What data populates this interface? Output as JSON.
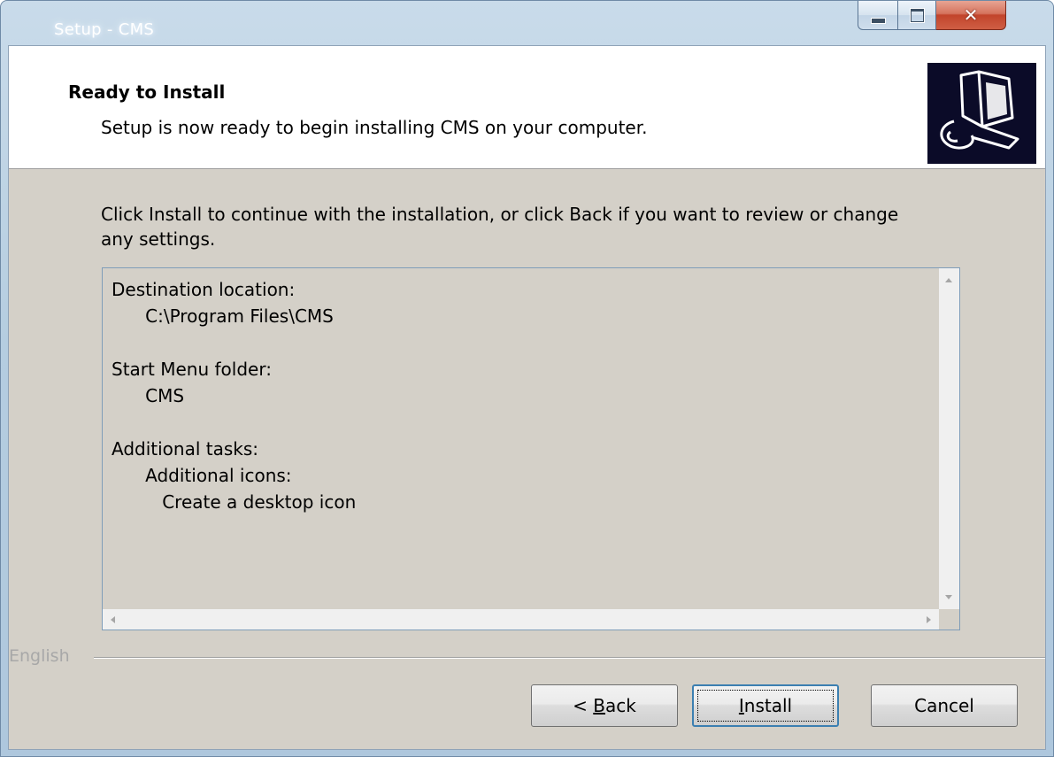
{
  "window": {
    "title": "Setup - CMS"
  },
  "header": {
    "title": "Ready to Install",
    "subtitle": "Setup is now ready to begin installing CMS on your computer."
  },
  "description": "Click Install to continue with the installation, or click Back if you want to review or change any settings.",
  "summary": {
    "text": "Destination location:\n      C:\\Program Files\\CMS\n\nStart Menu folder:\n      CMS\n\nAdditional tasks:\n      Additional icons:\n         Create a desktop icon"
  },
  "footer": {
    "language": "English"
  },
  "buttons": {
    "back": {
      "prefix": "< ",
      "accel": "B",
      "rest": "ack"
    },
    "install": {
      "accel": "I",
      "rest": "nstall"
    },
    "cancel": {
      "label": "Cancel"
    }
  },
  "icons": {
    "minimize": "minimize-icon",
    "maximize": "maximize-icon",
    "close": "close-icon",
    "wizard": "computer-install-icon"
  },
  "colors": {
    "client_bg": "#d4d0c8",
    "header_bg": "#ffffff",
    "close_button": "#c2442b",
    "focus_border": "#3c7fb1"
  }
}
